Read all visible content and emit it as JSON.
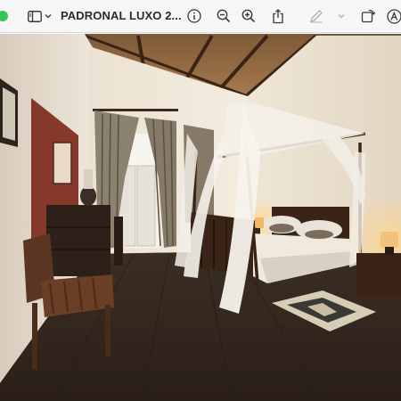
{
  "window": {
    "title": "PADRONAL LUXO 2...",
    "accent_color": "#35c759"
  },
  "toolbar": {
    "buttons": [
      {
        "id": "sidebar",
        "icon": "sidebar-icon"
      },
      {
        "id": "sidebar-menu",
        "icon": "chevron-down-icon"
      },
      {
        "id": "info",
        "icon": "info-icon"
      },
      {
        "id": "zoom-out",
        "icon": "zoom-out-icon"
      },
      {
        "id": "zoom-in",
        "icon": "zoom-in-icon"
      },
      {
        "id": "share",
        "icon": "share-icon"
      },
      {
        "id": "markup",
        "icon": "pencil-icon"
      },
      {
        "id": "markup-menu",
        "icon": "chevron-down-icon"
      },
      {
        "id": "rotate",
        "icon": "rotate-icon"
      },
      {
        "id": "annotate",
        "icon": "annotate-icon"
      }
    ]
  },
  "image": {
    "subject": "hotel-bedroom-photo",
    "colors": {
      "ceiling": "#8a6440",
      "wall": "#efe6d8",
      "accent_wall": "#8a3a2e",
      "floor": "#3a2c22",
      "canopy": "#f4f1ea"
    }
  }
}
